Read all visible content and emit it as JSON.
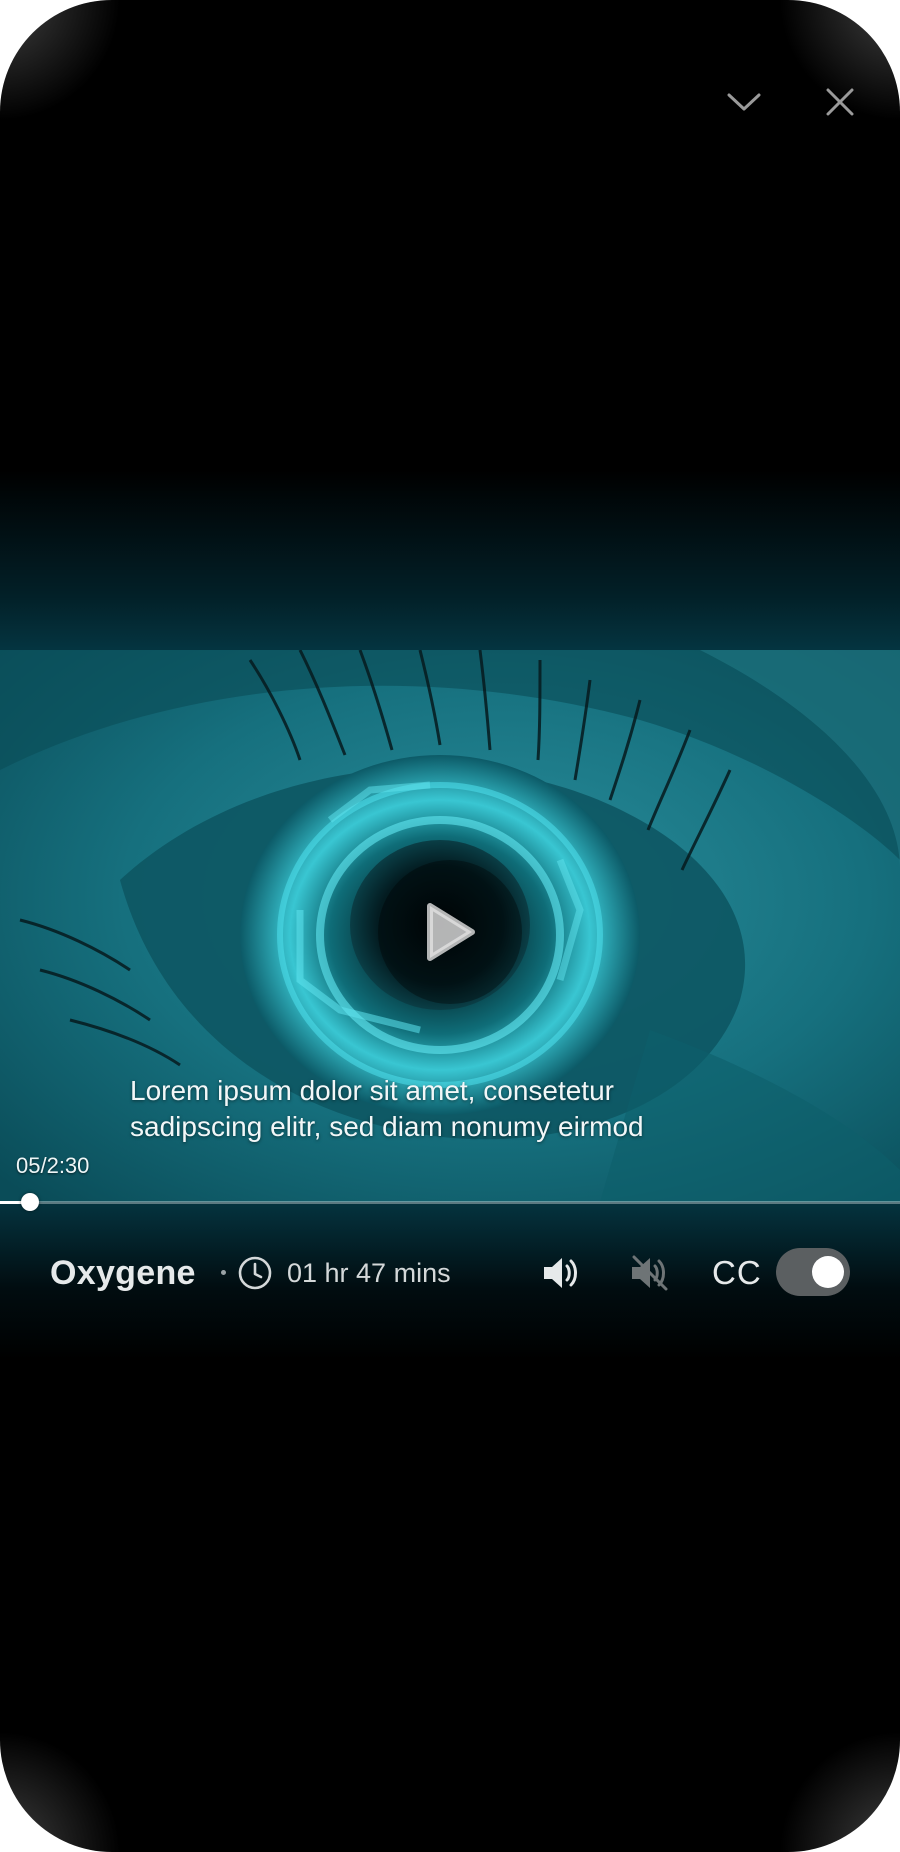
{
  "window_controls": {
    "minimize_icon": "chevron-down-icon",
    "close_icon": "close-icon"
  },
  "video": {
    "subtitle_lines": [
      "Lorem ipsum dolor sit amet, consetetur",
      "sadipscing elitr, sed diam nonumy eirmod"
    ],
    "time_readout": "05/2:30",
    "progress_fraction": 0.033,
    "play_icon": "play-icon"
  },
  "info": {
    "title": "Oxygene",
    "duration": "01 hr 47 mins",
    "clock_icon": "clock-icon",
    "volume_on_icon": "volume-on-icon",
    "volume_off_icon": "volume-muted-icon",
    "cc_label": "CC",
    "cc_enabled": true
  },
  "colors": {
    "background": "#000000",
    "accent_teal": "#0c5a67",
    "glow": "#06465a",
    "toggle_track": "#5b5f61",
    "text_primary": "#e6e9ea"
  }
}
